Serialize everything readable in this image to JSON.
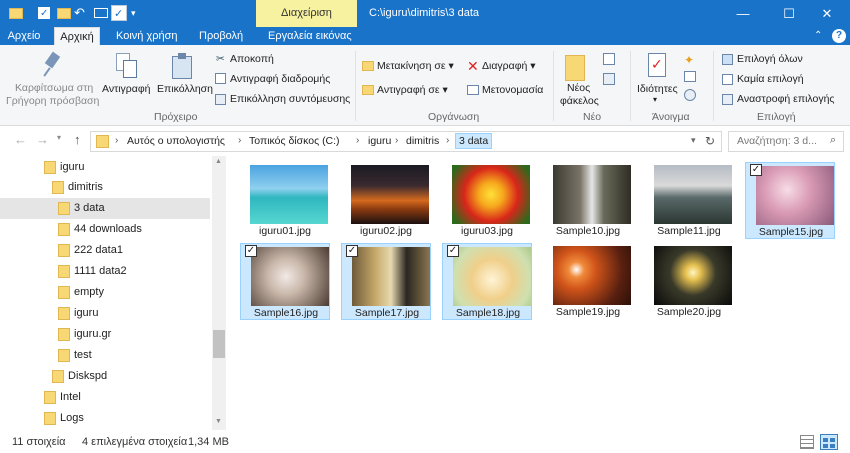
{
  "titlebar": {
    "context_tab": "Διαχείριση",
    "path": "C:\\iguru\\dimitris\\3 data",
    "minimize": "—",
    "maximize": "☐",
    "close": "✕"
  },
  "tabs": {
    "file": "Αρχείο",
    "home": "Αρχική",
    "share": "Κοινή χρήση",
    "view": "Προβολή",
    "picture_tools": "Εργαλεία εικόνας"
  },
  "ribbon": {
    "pin": [
      "Καρφίτσωμα στη",
      "Γρήγορη πρόσβαση"
    ],
    "copy": "Αντιγραφή",
    "paste": "Επικόλληση",
    "cut": "Αποκοπή",
    "copy_path": "Αντιγραφή διαδρομής",
    "paste_shortcut": "Επικόλληση συντόμευσης",
    "group_clipboard": "Πρόχειρο",
    "move_to": "Μετακίνηση σε",
    "copy_to": "Αντιγραφή σε",
    "delete": "Διαγραφή",
    "rename": "Μετονομασία",
    "group_organize": "Οργάνωση",
    "new_folder": [
      "Νέος",
      "φάκελος"
    ],
    "group_new": "Νέο",
    "properties": "Ιδιότητες",
    "group_open": "Άνοιγμα",
    "select_all": "Επιλογή όλων",
    "select_none": "Καμία επιλογή",
    "invert_selection": "Αναστροφή επιλογής",
    "group_select": "Επιλογή"
  },
  "address": {
    "crumbs": [
      "Αυτός ο υπολογιστής",
      "Τοπικός δίσκος (C:)",
      "iguru",
      "dimitris",
      "3 data"
    ],
    "search_placeholder": "Αναζήτηση: 3 d..."
  },
  "nav": {
    "items": [
      {
        "label": "iguru"
      },
      {
        "label": "dimitris"
      },
      {
        "label": "3 data"
      },
      {
        "label": "44 downloads"
      },
      {
        "label": "222 data1"
      },
      {
        "label": "1111 data2"
      },
      {
        "label": "empty"
      },
      {
        "label": "iguru"
      },
      {
        "label": "iguru.gr"
      },
      {
        "label": "test"
      },
      {
        "label": "Diskspd"
      },
      {
        "label": "Intel"
      },
      {
        "label": "Logs"
      }
    ]
  },
  "files": [
    {
      "name": "iguru01.jpg",
      "selected": false
    },
    {
      "name": "iguru02.jpg",
      "selected": false
    },
    {
      "name": "iguru03.jpg",
      "selected": false
    },
    {
      "name": "Sample10.jpg",
      "selected": false
    },
    {
      "name": "Sample11.jpg",
      "selected": false
    },
    {
      "name": "Sample15.jpg",
      "selected": true
    },
    {
      "name": "Sample16.jpg",
      "selected": true
    },
    {
      "name": "Sample17.jpg",
      "selected": true
    },
    {
      "name": "Sample18.jpg",
      "selected": true
    },
    {
      "name": "Sample19.jpg",
      "selected": false
    },
    {
      "name": "Sample20.jpg",
      "selected": false
    }
  ],
  "status": {
    "count": "11 στοιχεία",
    "selected": "4 επιλεγμένα στοιχεία",
    "size": "1,34 MB"
  },
  "colors": {
    "titlebar": "#1973c9",
    "context_tab": "#f7f2a0",
    "selection_bg": "#cce8ff",
    "selection_border": "#99d1ff"
  }
}
